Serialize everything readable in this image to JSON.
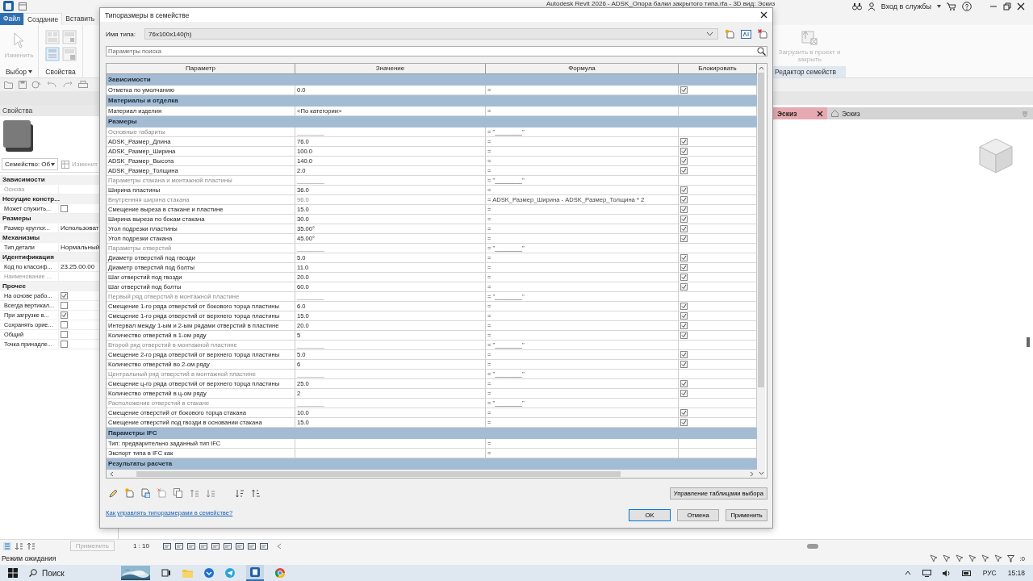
{
  "app": {
    "title": "Autodesk Revit 2026 - ADSK_Опора балки закрытого типа.rfa - 3D вид: Эскиз",
    "sign_in": "Вход в службы",
    "ribbon_tabs": [
      {
        "label": "Файл",
        "selected": false,
        "kind": "file"
      },
      {
        "label": "Создание",
        "selected": true,
        "kind": "tab"
      },
      {
        "label": "Вставить",
        "selected": false,
        "kind": "tab"
      }
    ],
    "ribbon": {
      "modify": "Изменить",
      "panels": [
        "Выбор",
        "Свойства"
      ],
      "load_button": "Загрузить в проект и закрыть",
      "editor_panel": "Редактор семейств"
    }
  },
  "properties": {
    "title": "Свойства",
    "type_selector": "Семейство: Об",
    "edit_type": "Изменит",
    "apply": "Применить",
    "groups": [
      {
        "label": "Зависимости",
        "rows": [
          {
            "name": "Основа",
            "kind": "text",
            "disabled": true
          }
        ]
      },
      {
        "label": "Несущие констр...",
        "rows": [
          {
            "name": "Может служить...",
            "kind": "checkbox",
            "checked": false,
            "disabled": false
          }
        ]
      },
      {
        "label": "Размеры",
        "rows": [
          {
            "name": "Размер круглог...",
            "kind": "text",
            "value": "Использоват",
            "disabled": false
          }
        ]
      },
      {
        "label": "Механизмы",
        "rows": [
          {
            "name": "Тип детали",
            "kind": "text",
            "value": "Нормальный",
            "disabled": false
          }
        ]
      },
      {
        "label": "Идентификация",
        "rows": [
          {
            "name": "Код по классиф...",
            "kind": "text",
            "value": "23.25.00.00",
            "disabled": false
          },
          {
            "name": "Наименование ...",
            "kind": "text",
            "disabled": true
          }
        ]
      },
      {
        "label": "Прочее",
        "rows": [
          {
            "name": "На основе рабо...",
            "kind": "checkbox",
            "checked": true,
            "disabled": false
          },
          {
            "name": "Всегда вертикал...",
            "kind": "checkbox",
            "checked": false,
            "disabled": false
          },
          {
            "name": "При загрузке в...",
            "kind": "checkbox",
            "checked": true,
            "disabled": false
          },
          {
            "name": "Сохранять орие...",
            "kind": "checkbox",
            "checked": false,
            "disabled": false
          },
          {
            "name": "Общий",
            "kind": "checkbox",
            "checked": false,
            "disabled": false
          },
          {
            "name": "Точка принадле...",
            "kind": "checkbox",
            "checked": false,
            "disabled": false
          }
        ]
      }
    ]
  },
  "view_tabs": [
    {
      "label": "Эскиз",
      "selected": true
    },
    {
      "label": "Эскиз",
      "selected": false
    }
  ],
  "view_bar": {
    "scale": "1 : 10"
  },
  "status_bar": {
    "text": "Режим ожидания",
    "filter_count": ":0"
  },
  "taskbar": {
    "search": "Поиск",
    "language": "РУС",
    "time": "15:18"
  },
  "dialog": {
    "title": "Типоразмеры в семействе",
    "type_label": "Имя типа:",
    "type_name": "76x100x140(h)",
    "search_placeholder": "Параметры поиска",
    "columns": [
      "Параметр",
      "Значение",
      "Формула",
      "Блокировать"
    ],
    "rows": [
      {
        "kind": "group",
        "name": "Зависимости"
      },
      {
        "kind": "param",
        "name": "Отметка по умолчанию",
        "value": "0.0",
        "formula": "=",
        "lock": true,
        "computed": false
      },
      {
        "kind": "group",
        "name": "Материалы и отделка"
      },
      {
        "kind": "param",
        "name": "Материал изделия",
        "value": "<По категории>",
        "formula": "=",
        "computed": false
      },
      {
        "kind": "group",
        "name": "Размеры"
      },
      {
        "kind": "label",
        "name": "Основные габариты",
        "value": "________",
        "formula": "= \"________\""
      },
      {
        "kind": "param",
        "name": "ADSK_Размер_Длина",
        "value": "76.0",
        "formula": "=",
        "lock": true,
        "computed": false
      },
      {
        "kind": "param",
        "name": "ADSK_Размер_Ширина",
        "value": "100.0",
        "formula": "=",
        "lock": true,
        "computed": false
      },
      {
        "kind": "param",
        "name": "ADSK_Размер_Высота",
        "value": "140.0",
        "formula": "=",
        "lock": true,
        "computed": false
      },
      {
        "kind": "param",
        "name": "ADSK_Размер_Толщина",
        "value": "2.0",
        "formula": "=",
        "lock": true,
        "computed": false
      },
      {
        "kind": "label",
        "name": "Параметры стакана и монтажной пластины",
        "value": "________",
        "formula": "= \"________\""
      },
      {
        "kind": "param",
        "name": "Ширина пластины",
        "value": "36.0",
        "formula": "=",
        "lock": true,
        "computed": false
      },
      {
        "kind": "param",
        "name": "Внутренняя ширина стакана",
        "value": "96.0",
        "formula": "= ADSK_Размер_Ширина - ADSK_Размер_Толщина * 2",
        "lock": true,
        "computed": true
      },
      {
        "kind": "param",
        "name": "Смещение выреза в стакане и пластине",
        "value": "15.0",
        "formula": "=",
        "lock": true,
        "computed": false
      },
      {
        "kind": "param",
        "name": "Ширина выреза по бокам стакана",
        "value": "30.0",
        "formula": "=",
        "lock": true,
        "computed": false
      },
      {
        "kind": "param",
        "name": "Угол подрезки пластины",
        "value": "35.00°",
        "formula": "=",
        "lock": true,
        "computed": false
      },
      {
        "kind": "param",
        "name": "Угол подрезки стакана",
        "value": "45.00°",
        "formula": "=",
        "lock": true,
        "computed": false
      },
      {
        "kind": "label",
        "name": "Параметры отверстий",
        "value": "________",
        "formula": "= \"________\""
      },
      {
        "kind": "param",
        "name": "Диаметр отверстий под гвозди",
        "value": "5.0",
        "formula": "=",
        "lock": true,
        "computed": false
      },
      {
        "kind": "param",
        "name": "Диаметр отверстий под болты",
        "value": "11.0",
        "formula": "=",
        "lock": true,
        "computed": false
      },
      {
        "kind": "param",
        "name": "Шаг отверстий под гвозди",
        "value": "20.0",
        "formula": "=",
        "lock": true,
        "computed": false
      },
      {
        "kind": "param",
        "name": "Шаг отверстий под болты",
        "value": "60.0",
        "formula": "=",
        "lock": true,
        "computed": false
      },
      {
        "kind": "label",
        "name": "Первый ряд отверстий в монтажной пластине",
        "value": "________",
        "formula": "= \"________\""
      },
      {
        "kind": "param",
        "name": "Смещение 1-го ряда отверстий от бокового торца пластины",
        "value": "6.0",
        "formula": "=",
        "lock": true,
        "computed": false
      },
      {
        "kind": "param",
        "name": "Смещение 1-го ряда отверстий от верхнего торца пластины",
        "value": "15.0",
        "formula": "=",
        "lock": true,
        "computed": false
      },
      {
        "kind": "param",
        "name": "Интервал между 1-ым и 2-ым рядами отверстий в пластине",
        "value": "20.0",
        "formula": "=",
        "lock": true,
        "computed": false
      },
      {
        "kind": "param",
        "name": "Количество отверстий в 1-ом ряду",
        "value": "5",
        "formula": "=",
        "lock": true,
        "computed": false
      },
      {
        "kind": "label",
        "name": "Второй ряд отверстий в монтажной пластине",
        "value": "________",
        "formula": "= \"________\""
      },
      {
        "kind": "param",
        "name": "Смещение 2-го ряда отверстий от верхнего торца пластины",
        "value": "5.0",
        "formula": "=",
        "lock": true,
        "computed": false
      },
      {
        "kind": "param",
        "name": "Количество отверстий во 2-ом ряду",
        "value": "6",
        "formula": "=",
        "lock": true,
        "computed": false
      },
      {
        "kind": "label",
        "name": "Центральный ряд отверстий в монтажной пластине",
        "value": "________",
        "formula": "= \"________\""
      },
      {
        "kind": "param",
        "name": "Смещение ц-го ряда отверстий от верхнего торца пластины",
        "value": "25.0",
        "formula": "=",
        "lock": true,
        "computed": false
      },
      {
        "kind": "param",
        "name": "Количество отверстий в ц-ом ряду",
        "value": "2",
        "formula": "=",
        "lock": true,
        "computed": false
      },
      {
        "kind": "label",
        "name": "Расположение отверстий в стакане",
        "value": "________",
        "formula": "= \"________\""
      },
      {
        "kind": "param",
        "name": "Смещение отверстий от бокового торца стакана",
        "value": "10.0",
        "formula": "=",
        "lock": true,
        "computed": false
      },
      {
        "kind": "param",
        "name": "Смещение отверстий под гвозди в основании стакана",
        "value": "15.0",
        "formula": "=",
        "lock": true,
        "computed": false
      },
      {
        "kind": "group",
        "name": "Параметры IFC"
      },
      {
        "kind": "param",
        "name": "Тип: предварительно заданный тип IFC",
        "formula": "=",
        "computed": false
      },
      {
        "kind": "param",
        "name": "Экспорт типа в IFC как",
        "formula": "=",
        "computed": false
      },
      {
        "kind": "group",
        "name": "Результаты расчета"
      }
    ],
    "lookup_button": "Управление таблицами выбора",
    "help_link": "Как управлять типоразмерами в семействе?",
    "buttons": [
      "OK",
      "Отмена",
      "Применить"
    ]
  }
}
